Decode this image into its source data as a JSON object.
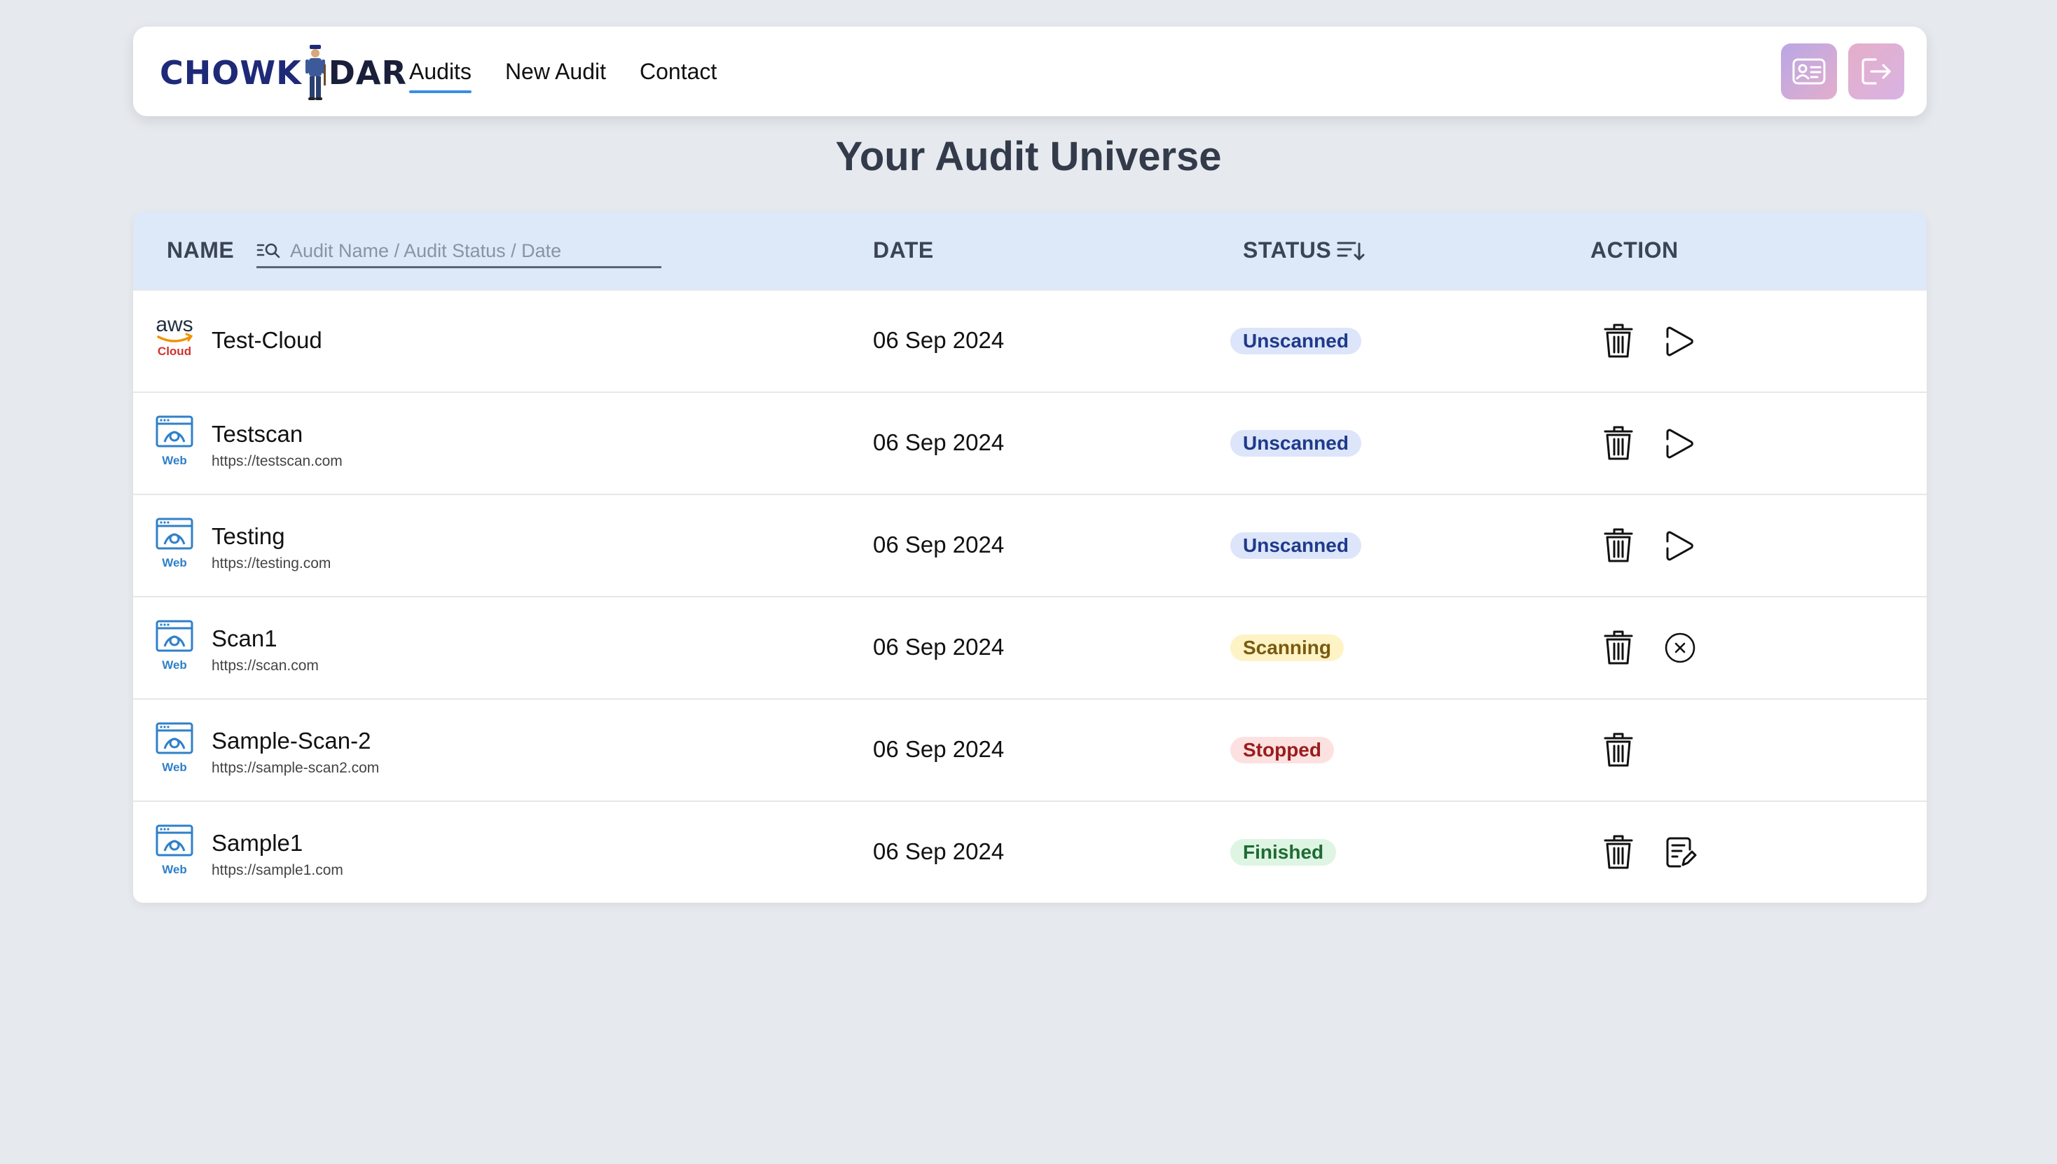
{
  "nav": {
    "logo_left": "CHOWK",
    "logo_right": "DAR",
    "links": [
      {
        "label": "Audits",
        "active": true
      },
      {
        "label": "New Audit",
        "active": false
      },
      {
        "label": "Contact",
        "active": false
      }
    ],
    "profile_icon": "id-card-icon",
    "logout_icon": "logout-icon"
  },
  "page": {
    "title": "Your Audit Universe"
  },
  "table": {
    "headers": {
      "name": "NAME",
      "date": "DATE",
      "status": "STATUS",
      "action": "ACTION"
    },
    "search_placeholder": "Audit Name / Audit Status / Date",
    "rows": [
      {
        "name": "Test-Cloud",
        "url": "",
        "type": "Cloud",
        "provider_label": "aws",
        "date": "06 Sep 2024",
        "status": "Unscanned",
        "action": "play"
      },
      {
        "name": "Testscan",
        "url": "https://testscan.com",
        "type": "Web",
        "date": "06 Sep 2024",
        "status": "Unscanned",
        "action": "play"
      },
      {
        "name": "Testing",
        "url": "https://testing.com",
        "type": "Web",
        "date": "06 Sep 2024",
        "status": "Unscanned",
        "action": "play"
      },
      {
        "name": "Scan1",
        "url": "https://scan.com",
        "type": "Web",
        "date": "06 Sep 2024",
        "status": "Scanning",
        "action": "stop"
      },
      {
        "name": "Sample-Scan-2",
        "url": "https://sample-scan2.com",
        "type": "Web",
        "date": "06 Sep 2024",
        "status": "Stopped",
        "action": "none"
      },
      {
        "name": "Sample1",
        "url": "https://sample1.com",
        "type": "Web",
        "date": "06 Sep 2024",
        "status": "Finished",
        "action": "report"
      }
    ]
  },
  "status_colors": {
    "Unscanned": {
      "bg": "#dde5fa",
      "fg": "#1e3a8a"
    },
    "Scanning": {
      "bg": "#fdf3c4",
      "fg": "#7a5a10"
    },
    "Stopped": {
      "bg": "#fde1e1",
      "fg": "#9b1c1c"
    },
    "Finished": {
      "bg": "#ddf5e2",
      "fg": "#1f6b34"
    }
  },
  "colors": {
    "accent": "#3a8ee6",
    "header_bg": "#dde8f8",
    "page_bg": "#e6e9ee",
    "aws_orange": "#f29100",
    "cloud_red": "#d0342c",
    "web_blue": "#2f80c9"
  }
}
